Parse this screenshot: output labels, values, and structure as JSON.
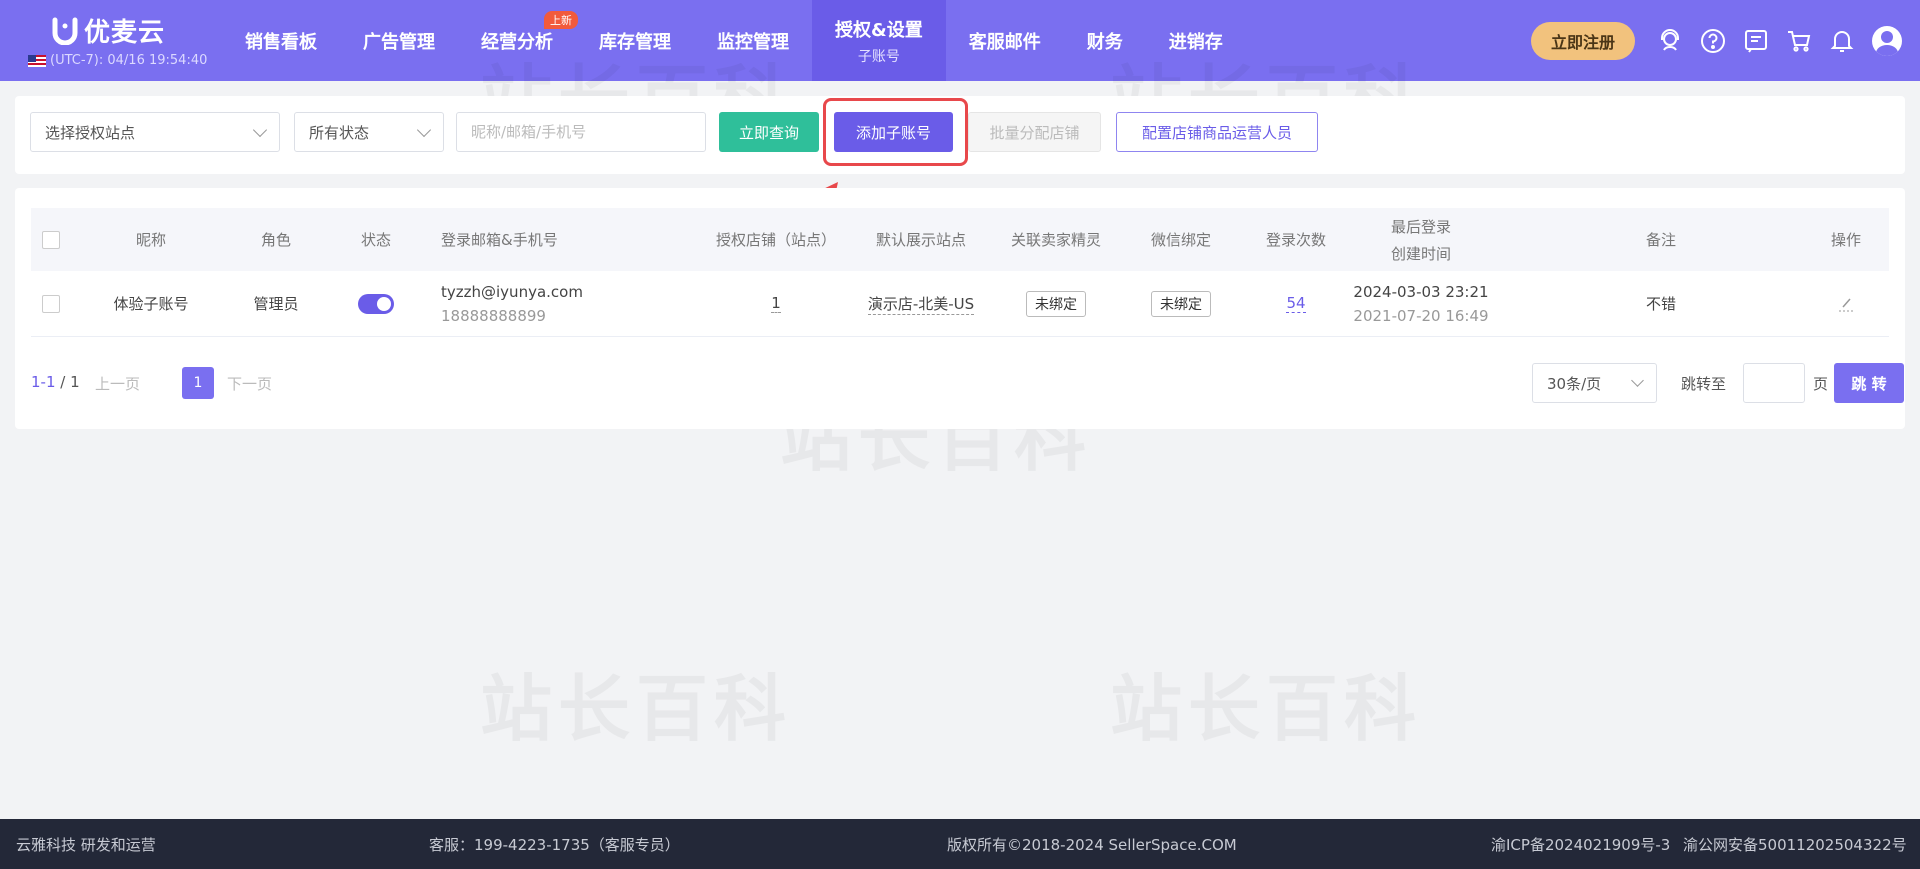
{
  "brand": {
    "name": "优麦云",
    "clock": "(UTC-7): 04/16 19:54:40"
  },
  "nav": {
    "items": [
      {
        "label": "销售看板"
      },
      {
        "label": "广告管理"
      },
      {
        "label": "经营分析",
        "badge": "上新"
      },
      {
        "label": "库存管理"
      },
      {
        "label": "监控管理"
      },
      {
        "label": "授权&设置",
        "sub": "子账号",
        "active": true
      },
      {
        "label": "客服邮件"
      },
      {
        "label": "财务"
      },
      {
        "label": "进销存"
      }
    ],
    "register_label": "立即注册"
  },
  "filters": {
    "site_select": "选择授权站点",
    "status_select": "所有状态",
    "search_placeholder": "昵称/邮箱/手机号",
    "query_label": "立即查询",
    "add_label": "添加子账号",
    "batch_label": "批量分配店铺",
    "config_label": "配置店铺商品运营人员"
  },
  "table": {
    "headers": {
      "nickname": "昵称",
      "role": "角色",
      "status": "状态",
      "login": "登录邮箱&手机号",
      "shops": "授权店铺（站点）",
      "default_site": "默认展示站点",
      "seller_elf": "关联卖家精灵",
      "wechat": "微信绑定",
      "login_count": "登录次数",
      "last_login": "最后登录",
      "created": "创建时间",
      "remark": "备注",
      "actions": "操作"
    },
    "rows": [
      {
        "nickname": "体验子账号",
        "role": "管理员",
        "email": "tyzzh@iyunya.com",
        "phone": "18888888899",
        "shops": "1",
        "default_site": "演示店-北美-US",
        "seller_elf": "未绑定",
        "wechat": "未绑定",
        "login_count": "54",
        "last_login": "2024-03-03 23:21",
        "created": "2021-07-20 16:49",
        "remark": "不错"
      }
    ]
  },
  "pager": {
    "range": "1-1",
    "total": "/ 1",
    "prev": "上一页",
    "page": "1",
    "next": "下一页",
    "size": "30条/页",
    "goto": "跳转至",
    "page_unit": "页",
    "jump": "跳 转"
  },
  "watermark": "站长百科",
  "footer": {
    "company": "云雅科技 研发和运营",
    "service": "客服：199-4223-1735（客服专员）",
    "copyright": "版权所有©2018-2024 SellerSpace.COM",
    "icp": "渝ICP备2024021909号-3",
    "police": "渝公网安备50011202504322号"
  },
  "colors": {
    "primary": "#7a6ff0",
    "accent": "#6a5ce8",
    "success": "#2fbf9a",
    "register": "#f2c27d",
    "highlight": "#e8484b"
  }
}
